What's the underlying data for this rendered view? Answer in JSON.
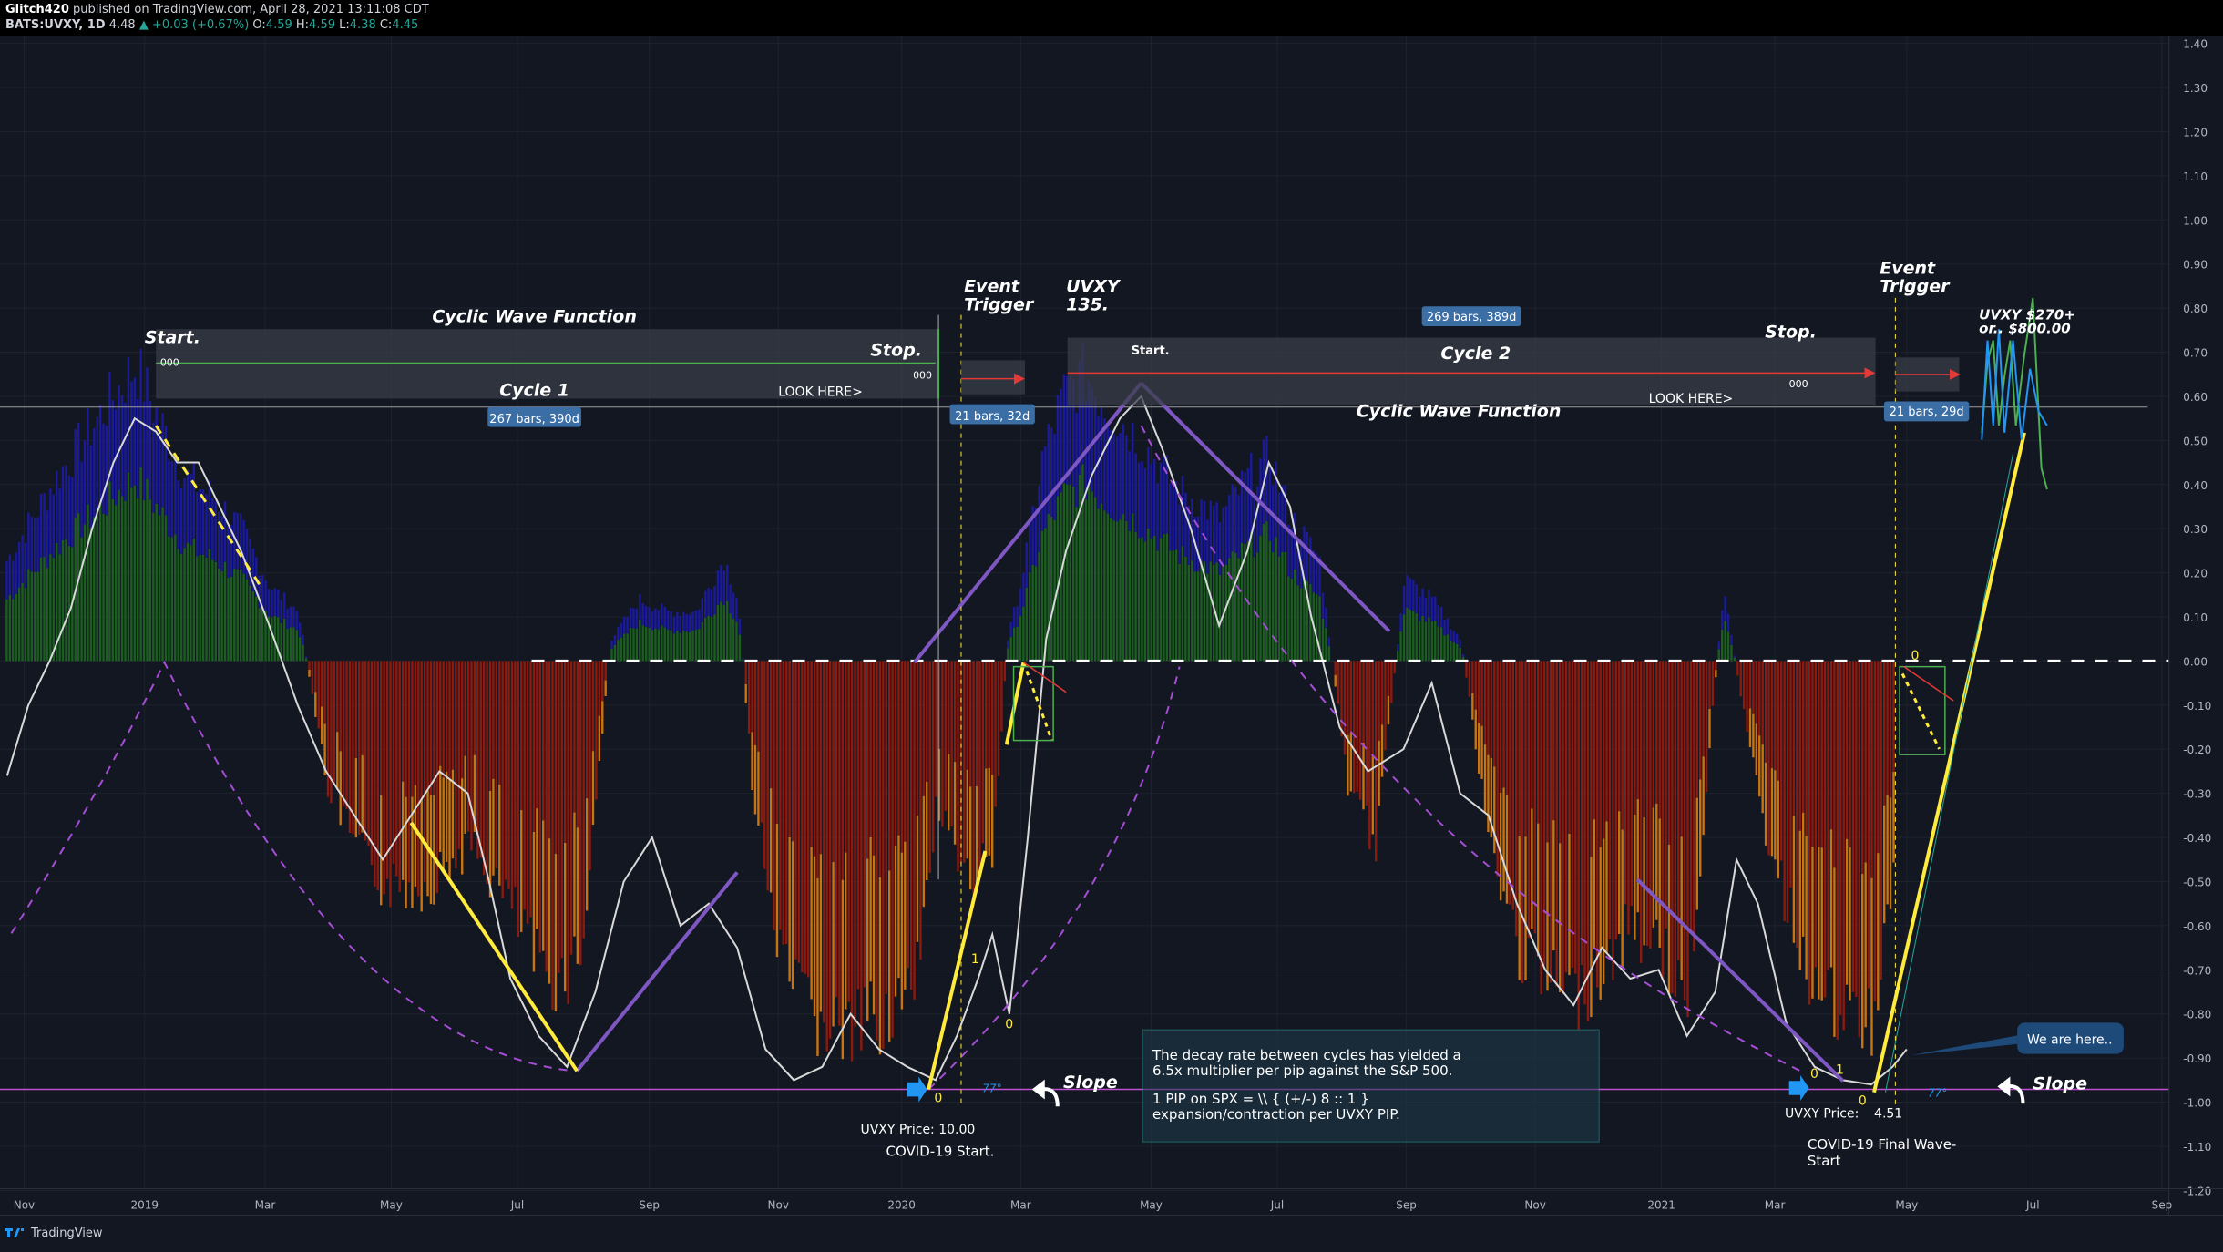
{
  "header": {
    "publisher": "Glitch420",
    "published_text": "published on TradingView.com, April 28, 2021 13:11:08 CDT",
    "symbol": "BATS:UVXY, 1D",
    "last": "4.48",
    "change": "▲ +0.03 (+0.67%)",
    "ohlc": [
      {
        "k": "O:",
        "v": "4.59"
      },
      {
        "k": "H:",
        "v": "4.59"
      },
      {
        "k": "L:",
        "v": "4.38"
      },
      {
        "k": "C:",
        "v": "4.45"
      }
    ]
  },
  "footer": {
    "brand": "TradingView"
  },
  "colors": {
    "bg": "#131722",
    "blue": "#1a1a9a",
    "green": "#1b5e20",
    "red": "#8b1a0f",
    "orange": "#c87410",
    "white_line": "#d9d9d9",
    "yellow": "#ffeb3b",
    "purple": "#7e57c2",
    "purple_dash": "#a64dd6",
    "magenta_line": "#c050d0",
    "box_fill": "#3a3d48"
  },
  "chart_data": {
    "type": "bar",
    "x_axis_labels": [
      "Nov",
      "2019",
      "Mar",
      "May",
      "Jul",
      "Sep",
      "Nov",
      "2020",
      "Mar",
      "May",
      "Jul",
      "Sep",
      "Nov",
      "2021",
      "Mar",
      "May",
      "Jul",
      "Sep"
    ],
    "y_axis_labels": [
      "1.40",
      "1.30",
      "1.20",
      "1.10",
      "1.00",
      "0.90",
      "0.80",
      "0.70",
      "0.60",
      "0.50",
      "0.40",
      "0.30",
      "0.20",
      "0.10",
      "0.00",
      "-0.10",
      "-0.20",
      "-0.30",
      "-0.40",
      "-0.50",
      "-0.60",
      "-0.70",
      "-0.80",
      "-0.90",
      "-1.00",
      "-1.10",
      "-1.20"
    ],
    "ylim": [
      -1.2,
      1.4
    ],
    "histogram_envelope": [
      [
        0,
        0.22
      ],
      [
        40,
        0.45
      ],
      [
        60,
        0.55
      ],
      [
        80,
        0.65
      ],
      [
        95,
        0.72
      ],
      [
        110,
        0.6
      ],
      [
        130,
        0.45
      ],
      [
        150,
        0.4
      ],
      [
        170,
        0.32
      ],
      [
        190,
        0.18
      ],
      [
        210,
        0.12
      ],
      [
        230,
        -0.3
      ],
      [
        250,
        -0.45
      ],
      [
        270,
        -0.55
      ],
      [
        300,
        -0.55
      ],
      [
        330,
        -0.45
      ],
      [
        360,
        -0.6
      ],
      [
        380,
        -0.75
      ],
      [
        395,
        -0.78
      ],
      [
        410,
        -0.7
      ],
      [
        430,
        0.05
      ],
      [
        450,
        0.15
      ],
      [
        470,
        0.12
      ],
      [
        490,
        0.12
      ],
      [
        510,
        0.25
      ],
      [
        520,
        0.15
      ],
      [
        530,
        -0.3
      ],
      [
        550,
        -0.75
      ],
      [
        575,
        -0.88
      ],
      [
        600,
        -0.92
      ],
      [
        625,
        -0.85
      ],
      [
        645,
        -0.82
      ],
      [
        660,
        -0.35
      ],
      [
        680,
        -0.55
      ],
      [
        700,
        -0.45
      ],
      [
        710,
        0.05
      ],
      [
        720,
        0.2
      ],
      [
        735,
        0.5
      ],
      [
        750,
        0.65
      ],
      [
        765,
        0.7
      ],
      [
        780,
        0.62
      ],
      [
        800,
        0.55
      ],
      [
        830,
        0.42
      ],
      [
        860,
        0.35
      ],
      [
        880,
        0.45
      ],
      [
        895,
        0.5
      ],
      [
        910,
        0.35
      ],
      [
        930,
        0.25
      ],
      [
        950,
        -0.3
      ],
      [
        970,
        -0.45
      ],
      [
        990,
        0.2
      ],
      [
        1010,
        0.15
      ],
      [
        1030,
        0.05
      ],
      [
        1050,
        -0.45
      ],
      [
        1070,
        -0.7
      ],
      [
        1090,
        -0.78
      ],
      [
        1110,
        -0.82
      ],
      [
        1130,
        -0.75
      ],
      [
        1150,
        -0.65
      ],
      [
        1170,
        -0.7
      ],
      [
        1190,
        -0.82
      ],
      [
        1215,
        0.18
      ],
      [
        1240,
        -0.35
      ],
      [
        1260,
        -0.6
      ],
      [
        1280,
        -0.8
      ],
      [
        1300,
        -0.88
      ],
      [
        1320,
        -0.88
      ],
      [
        1336,
        -0.5
      ]
    ],
    "oscillator_line": [
      [
        5,
        -0.26
      ],
      [
        20,
        -0.1
      ],
      [
        35,
        0.0
      ],
      [
        50,
        0.12
      ],
      [
        65,
        0.3
      ],
      [
        80,
        0.45
      ],
      [
        95,
        0.55
      ],
      [
        110,
        0.52
      ],
      [
        125,
        0.45
      ],
      [
        140,
        0.45
      ],
      [
        155,
        0.35
      ],
      [
        170,
        0.25
      ],
      [
        190,
        0.08
      ],
      [
        210,
        -0.1
      ],
      [
        230,
        -0.25
      ],
      [
        250,
        -0.35
      ],
      [
        270,
        -0.45
      ],
      [
        290,
        -0.35
      ],
      [
        310,
        -0.25
      ],
      [
        330,
        -0.3
      ],
      [
        345,
        -0.5
      ],
      [
        360,
        -0.72
      ],
      [
        380,
        -0.85
      ],
      [
        400,
        -0.92
      ],
      [
        420,
        -0.75
      ],
      [
        440,
        -0.5
      ],
      [
        460,
        -0.4
      ],
      [
        480,
        -0.6
      ],
      [
        500,
        -0.55
      ],
      [
        520,
        -0.65
      ],
      [
        540,
        -0.88
      ],
      [
        560,
        -0.95
      ],
      [
        580,
        -0.92
      ],
      [
        600,
        -0.8
      ],
      [
        620,
        -0.88
      ],
      [
        640,
        -0.92
      ],
      [
        660,
        -0.95
      ],
      [
        675,
        -0.85
      ],
      [
        690,
        -0.72
      ],
      [
        700,
        -0.62
      ],
      [
        712,
        -0.8
      ],
      [
        725,
        -0.4
      ],
      [
        738,
        0.05
      ],
      [
        752,
        0.25
      ],
      [
        770,
        0.42
      ],
      [
        790,
        0.55
      ],
      [
        805,
        0.6
      ],
      [
        820,
        0.48
      ],
      [
        840,
        0.3
      ],
      [
        860,
        0.08
      ],
      [
        880,
        0.25
      ],
      [
        895,
        0.45
      ],
      [
        910,
        0.35
      ],
      [
        925,
        0.1
      ],
      [
        945,
        -0.15
      ],
      [
        965,
        -0.25
      ],
      [
        990,
        -0.2
      ],
      [
        1010,
        -0.05
      ],
      [
        1030,
        -0.3
      ],
      [
        1050,
        -0.35
      ],
      [
        1070,
        -0.55
      ],
      [
        1090,
        -0.7
      ],
      [
        1110,
        -0.78
      ],
      [
        1130,
        -0.65
      ],
      [
        1150,
        -0.72
      ],
      [
        1170,
        -0.7
      ],
      [
        1190,
        -0.85
      ],
      [
        1210,
        -0.75
      ],
      [
        1225,
        -0.45
      ],
      [
        1240,
        -0.55
      ],
      [
        1260,
        -0.82
      ],
      [
        1280,
        -0.92
      ],
      [
        1300,
        -0.95
      ],
      [
        1320,
        -0.96
      ],
      [
        1335,
        -0.92
      ],
      [
        1345,
        -0.88
      ]
    ]
  },
  "annotations": {
    "cyclic_wave_1": "Cyclic Wave Function",
    "start_1": "Start.",
    "stop_1": "Stop.",
    "cycle_1": "Cycle 1",
    "look_here_1": "LOOK HERE>",
    "bars_1": "267 bars, 390d",
    "zeros_1a": "000",
    "zeros_1b": "000",
    "event_trigger_1": "Event\nTrigger",
    "bars_trigger_1": "21 bars, 32d",
    "uvxy_135": "UVXY\n135.",
    "start_2": "Start.",
    "bars_2": "269 bars, 389d",
    "cycle_2": "Cycle 2",
    "stop_2": "Stop.",
    "zeros_2": "000",
    "look_here_2": "LOOK HERE>",
    "cyclic_wave_2": "Cyclic Wave Function",
    "event_trigger_2": "Event\nTrigger",
    "bars_trigger_2": "21 bars, 29d",
    "uvxy_target": "UVXY $270+\nor.. $800.00",
    "slope_1": "Slope",
    "slope_2": "Slope",
    "angle_1": "77°",
    "angle_2": "77°",
    "uvxy_price_1": "UVXY Price:  10.00",
    "covid_start": "COVID-19 Start.",
    "uvxy_price_2": "UVXY Price:",
    "uvxy_price_2_val": "4.51",
    "covid_final": "COVID-19 Final Wave-\nStart",
    "we_are_here": "We are here..",
    "note_line1": "The decay rate between cycles has yielded a",
    "note_line2": "6.5x multiplier per pip against the S&P 500.",
    "note_line3": "1 PIP on SPX = \\\\  { (+/-)  8 :: 1 }",
    "note_line4": "expansion/contraction per UVXY PIP.",
    "fib_0a": "0",
    "fib_1a": "1",
    "fib_0b": "0",
    "fib_0c": "0",
    "fib_1c": "1",
    "fib_0d": "0",
    "fib_0e": "0"
  }
}
